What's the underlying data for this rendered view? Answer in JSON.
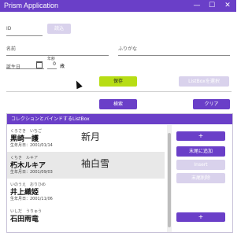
{
  "window": {
    "title": "Prism Application",
    "minimize": "—",
    "maximize": "☐",
    "close": "✕"
  },
  "form": {
    "id_label": "ID",
    "read_button": "読込",
    "name_label": "名前",
    "kana_label": "ふりがな",
    "birthday_label": "誕生日",
    "age_label": "年齢",
    "age_value": "0",
    "age_unit": "歳",
    "save_button": "保存",
    "listbox_select_button": "ListBoxを選択",
    "search_button": "検索",
    "clear_button": "クリア"
  },
  "panel": {
    "header": "コレクションとバインドするListBox",
    "items": [
      {
        "kana": "くろさき　いちご",
        "name": "黒崎一護",
        "birth": "生年月日：2001/01/14",
        "era": "新月"
      },
      {
        "kana": "くちき　ルキア",
        "name": "朽木ルキア",
        "birth": "生年月日：2001/09/03",
        "era": "袖白雪"
      },
      {
        "kana": "いのうえ　おりひめ",
        "name": "井上織姫",
        "birth": "生年月日：2001/11/06",
        "era": ""
      },
      {
        "kana": "いしだ　うりゅう",
        "name": "石田雨竜",
        "birth": "",
        "era": ""
      }
    ],
    "add_top": "+",
    "add_end": "末尾に追加",
    "insert": "Insert",
    "delete_last": "末尾削除",
    "add_bottom": "+"
  }
}
